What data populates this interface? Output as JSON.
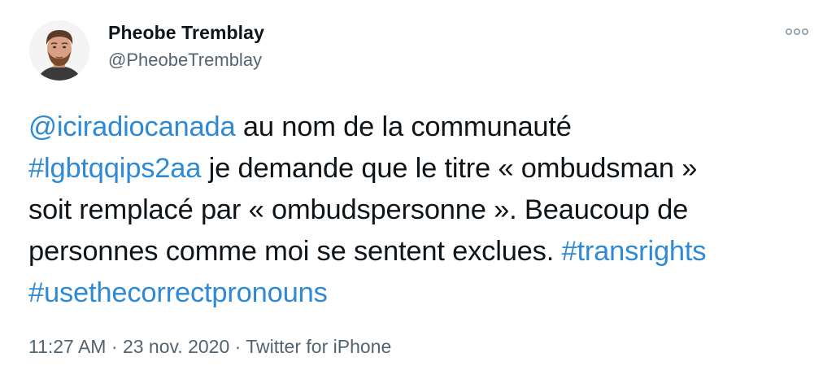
{
  "author": {
    "display_name": "Pheobe Tremblay",
    "handle": "@PheobeTremblay"
  },
  "more_icon": "more-horizontal-icon",
  "tweet": {
    "lines": [
      [
        {
          "text": "@iciradiocanada",
          "type": "mention"
        },
        {
          "text": " au nom de la communauté",
          "type": "text"
        }
      ],
      [
        {
          "text": "#lgbtqqips2aa",
          "type": "hashtag"
        },
        {
          "text": " je demande que le titre « ombudsman »",
          "type": "text"
        }
      ],
      [
        {
          "text": "soit remplacé par « ombudspersonne ». Beaucoup de",
          "type": "text"
        }
      ],
      [
        {
          "text": "personnes comme moi se sentent exclues. ",
          "type": "text"
        },
        {
          "text": "#transrights",
          "type": "hashtag"
        }
      ],
      [
        {
          "text": "#usethecorrectpronouns",
          "type": "hashtag"
        }
      ]
    ]
  },
  "meta": {
    "time": "11:27 AM",
    "separator": " · ",
    "date": "23 nov. 2020",
    "source": "Twitter for iPhone"
  },
  "colors": {
    "link": "#2f8ad6",
    "text": "#0f1419",
    "secondary": "#536471"
  }
}
